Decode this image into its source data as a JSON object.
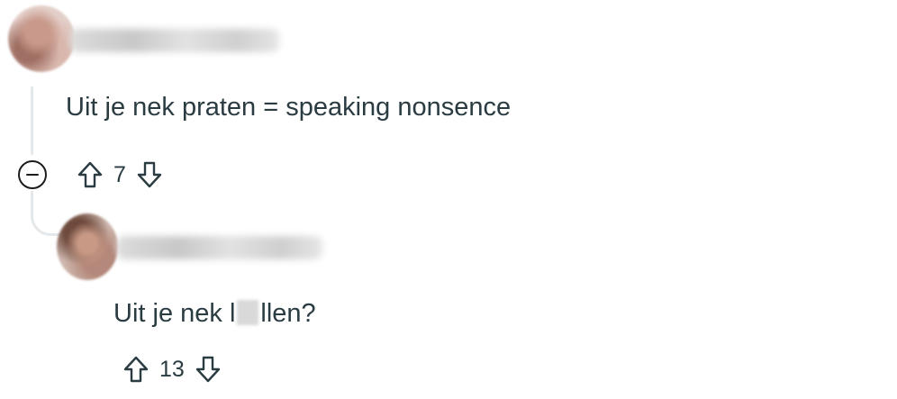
{
  "thread": {
    "comments": [
      {
        "author_name": "",
        "body": "Uit je nek praten = speaking nonsence",
        "score": "7",
        "collapse_icon": "minus-circle-icon",
        "upvote_icon": "arrow-up-outline-icon",
        "downvote_icon": "arrow-down-outline-icon"
      },
      {
        "author_name": "",
        "body_prefix": "Uit je nek l",
        "body_suffix": "llen?",
        "score": "13",
        "upvote_icon": "arrow-up-outline-icon",
        "downvote_icon": "arrow-down-outline-icon"
      }
    ]
  },
  "colors": {
    "text": "#2a3c42",
    "thread_line": "#e5e8ea",
    "icon_stroke": "#2a3c42"
  }
}
